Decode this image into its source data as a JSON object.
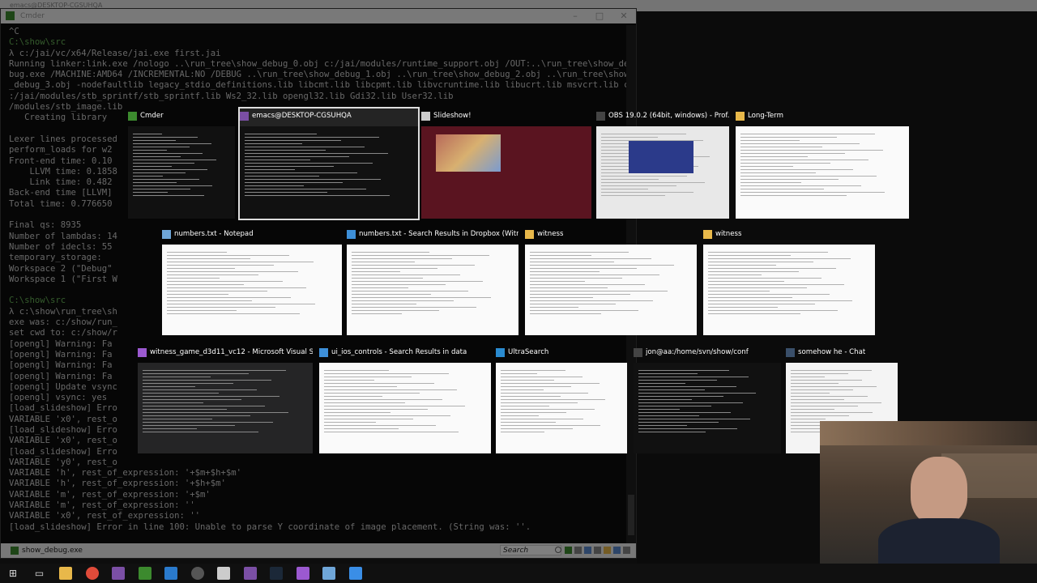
{
  "background_window_title": "emacs@DESKTOP-CGSUHQA",
  "cmder": {
    "title": "Cmder",
    "console_lines": [
      {
        "text": "^C",
        "kind": "out"
      },
      {
        "text": "C:\\show\\src",
        "kind": "cwd"
      },
      {
        "text": "λ c:/jai/vc/x64/Release/jai.exe first.jai",
        "kind": "out"
      },
      {
        "text": "Running linker:link.exe /nologo ..\\run_tree\\show_debug_0.obj c:/jai/modules/runtime_support.obj /OUT:..\\run_tree\\show_de",
        "kind": "out"
      },
      {
        "text": "bug.exe /MACHINE:AMD64 /INCREMENTAL:NO /DEBUG ..\\run_tree\\show_debug_1.obj ..\\run_tree\\show_debug_2.obj ..\\run_tree\\show",
        "kind": "out"
      },
      {
        "text": "_debug_3.obj -nodefaultlib legacy_stdio_definitions.lib libcmt.lib libcpmt.lib libvcruntime.lib libucrt.lib msvcrt.lib c",
        "kind": "out"
      },
      {
        "text": ":/jai/modules/stb_sprintf/stb_sprintf.lib Ws2_32.lib opengl32.lib Gdi32.lib User32.lib",
        "kind": "out"
      },
      {
        "text": "/modules/stb_image.lib",
        "kind": "out"
      },
      {
        "text": "   Creating library ",
        "kind": "out"
      },
      {
        "text": "",
        "kind": "out"
      },
      {
        "text": "Lexer lines processed",
        "kind": "out"
      },
      {
        "text": "perform_loads for w2",
        "kind": "out"
      },
      {
        "text": "Front-end time: 0.10",
        "kind": "out"
      },
      {
        "text": "    LLVM time: 0.1858",
        "kind": "out"
      },
      {
        "text": "    Link time: 0.482",
        "kind": "out"
      },
      {
        "text": "Back-end time [LLVM]",
        "kind": "out"
      },
      {
        "text": "Total time: 0.776650",
        "kind": "out"
      },
      {
        "text": "",
        "kind": "out"
      },
      {
        "text": "Final qs: 8935",
        "kind": "out"
      },
      {
        "text": "Number of lambdas: 14",
        "kind": "out"
      },
      {
        "text": "Number of idecls: 55",
        "kind": "out"
      },
      {
        "text": "temporary_storage: ",
        "kind": "out"
      },
      {
        "text": "Workspace 2 (\"Debug\"",
        "kind": "out"
      },
      {
        "text": "Workspace 1 (\"First W",
        "kind": "out"
      },
      {
        "text": "",
        "kind": "out"
      },
      {
        "text": "C:\\show\\src",
        "kind": "cwd"
      },
      {
        "text": "λ c:\\show\\run_tree\\sh",
        "kind": "out"
      },
      {
        "text": "exe was: c:/show/run_",
        "kind": "out"
      },
      {
        "text": "set cwd to: c:/show/r",
        "kind": "out"
      },
      {
        "text": "[opengl] Warning: Fa",
        "kind": "out"
      },
      {
        "text": "[opengl] Warning: Fa",
        "kind": "out"
      },
      {
        "text": "[opengl] Warning: Fa",
        "kind": "out"
      },
      {
        "text": "[opengl] Warning: Fa",
        "kind": "out"
      },
      {
        "text": "[opengl] Update vsync",
        "kind": "out"
      },
      {
        "text": "[opengl] vsync: yes",
        "kind": "out"
      },
      {
        "text": "[load_slideshow] Erro",
        "kind": "out"
      },
      {
        "text": "VARIABLE 'x0', rest_o",
        "kind": "out"
      },
      {
        "text": "[load_slideshow] Erro",
        "kind": "out"
      },
      {
        "text": "VARIABLE 'x0', rest_o",
        "kind": "out"
      },
      {
        "text": "[load_slideshow] Erro",
        "kind": "out"
      },
      {
        "text": "VARIABLE 'y0', rest_o",
        "kind": "out"
      },
      {
        "text": "VARIABLE 'h', rest_of_expression: '+$m+$h+$m'",
        "kind": "out"
      },
      {
        "text": "VARIABLE 'h', rest_of_expression: '+$h+$m'",
        "kind": "out"
      },
      {
        "text": "VARIABLE 'm', rest_of_expression: '+$m'",
        "kind": "out"
      },
      {
        "text": "VARIABLE 'm', rest_of_expression: ''",
        "kind": "out"
      },
      {
        "text": "VARIABLE 'x0', rest_of_expression: ''",
        "kind": "out"
      },
      {
        "text": "[load_slideshow] Error in line 100: Unable to parse Y coordinate of image placement. (String was: ''.",
        "kind": "out"
      }
    ],
    "status_tab": "show_debug.exe",
    "search_placeholder": "Search"
  },
  "switcher": [
    {
      "title": "Cmder",
      "icon": "cmder-icon",
      "color": "#3c8a2e",
      "preview": "console",
      "selected": false
    },
    {
      "title": "emacs@DESKTOP-CGSUHQA",
      "icon": "emacs-icon",
      "color": "#7b4fa5",
      "preview": "editor",
      "selected": true
    },
    {
      "title": "Slideshow!",
      "icon": "slideshow-icon",
      "color": "#cccccc",
      "preview": "slide",
      "selected": false
    },
    {
      "title": "OBS 19.0.2 (64bit, windows) - Prof...",
      "icon": "obs-icon",
      "color": "#444444",
      "preview": "obs",
      "selected": false
    },
    {
      "title": "Long-Term",
      "icon": "folder-icon",
      "color": "#e8b84a",
      "preview": "explorer",
      "selected": false
    },
    {
      "title": "numbers.txt - Notepad",
      "icon": "notepad-icon",
      "color": "#6fa6d8",
      "preview": "notepad",
      "selected": false
    },
    {
      "title": "numbers.txt - Search Results in Dropbox (Witn...",
      "icon": "search-results-icon",
      "color": "#3d8fd8",
      "preview": "explorer",
      "selected": false
    },
    {
      "title": "witness",
      "icon": "folder-icon",
      "color": "#e8b84a",
      "preview": "explorer",
      "selected": false
    },
    {
      "title": "witness",
      "icon": "folder-icon",
      "color": "#e8b84a",
      "preview": "explorer",
      "selected": false
    },
    {
      "title": "witness_game_d3d11_vc12 - Microsoft Visual St...",
      "icon": "visual-studio-icon",
      "color": "#9b59d0",
      "preview": "vs",
      "selected": false
    },
    {
      "title": "ui_ios_controls - Search Results in data",
      "icon": "search-results-icon",
      "color": "#3d8fd8",
      "preview": "explorer",
      "selected": false
    },
    {
      "title": "UltraSearch",
      "icon": "ultrasearch-icon",
      "color": "#2a8bd0",
      "preview": "list",
      "selected": false
    },
    {
      "title": "jon@aa:/home/svn/show/conf",
      "icon": "terminal-icon",
      "color": "#444444",
      "preview": "terminal",
      "selected": false
    },
    {
      "title": "somehow he - Chat",
      "icon": "steam-icon",
      "color": "#3a4f6a",
      "preview": "chat",
      "selected": false
    }
  ],
  "taskbar": {
    "icons": [
      "windows-start-icon",
      "task-view-icon",
      "file-explorer-icon",
      "chrome-icon",
      "emacs-icon",
      "cmder-icon",
      "visual-studio-code-icon",
      "obs-icon",
      "slideshow-icon",
      "emacs-icon",
      "steam-icon",
      "visual-studio-icon",
      "notepad-icon",
      "app-icon"
    ]
  }
}
